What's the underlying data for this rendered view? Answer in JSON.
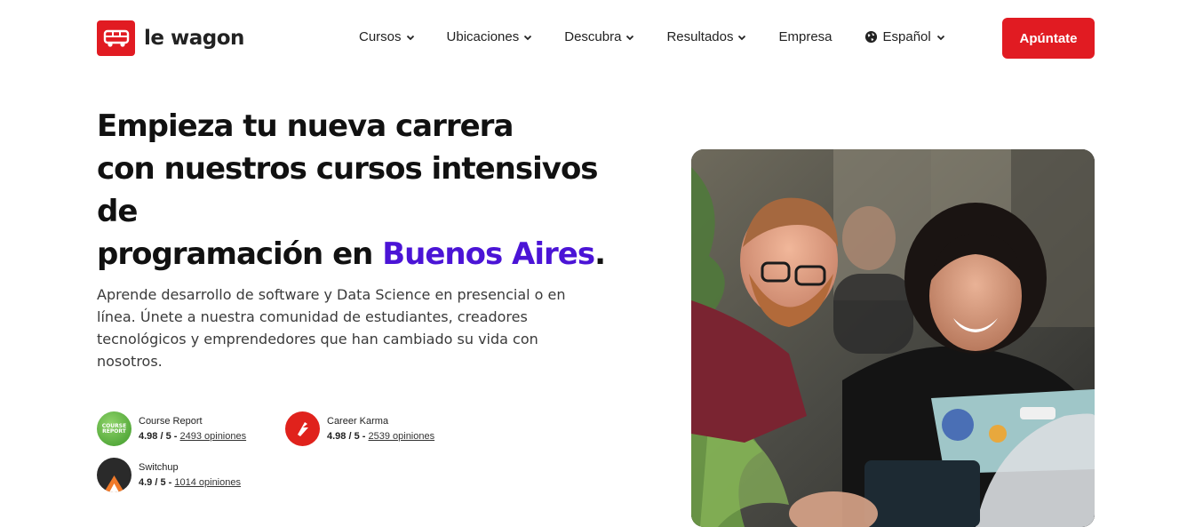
{
  "brand": {
    "name": "le wagon"
  },
  "nav": {
    "items": [
      {
        "label": "Cursos",
        "dropdown": true
      },
      {
        "label": "Ubicaciones",
        "dropdown": true
      },
      {
        "label": "Descubra",
        "dropdown": true
      },
      {
        "label": "Resultados",
        "dropdown": true
      },
      {
        "label": "Empresa",
        "dropdown": false
      }
    ],
    "language": {
      "label": "Español",
      "icon": "globe-icon"
    },
    "cta_label": "Apúntate"
  },
  "hero": {
    "headline_line1": "Empieza tu nueva carrera",
    "headline_line2": "con nuestros cursos intensivos de",
    "headline_line3_prefix": "programación en ",
    "headline_city": "Buenos Aires",
    "headline_suffix": ".",
    "intro": "Aprende desarrollo de software y Data Science en presencial o en línea. Únete a nuestra comunidad de estudiantes, creadores tecnológicos y emprendedores que han cambiado su vida con nosotros.",
    "photo_alt": "Estudiantes sonriendo frente a un portátil"
  },
  "reviews": [
    {
      "name": "Course Report",
      "score": "4.98 / 5",
      "sep": " - ",
      "link": "2493 opiniones",
      "badge_text": "COURSE REPORT"
    },
    {
      "name": "Career Karma",
      "score": "4.98 / 5",
      "sep": " - ",
      "link": "2539 opiniones"
    },
    {
      "name": "Switchup",
      "score": "4.9 / 5",
      "sep": " - ",
      "link": "1014 opiniones"
    }
  ],
  "colors": {
    "brand_red": "#e11b22",
    "accent_purple": "#4b14d6"
  }
}
